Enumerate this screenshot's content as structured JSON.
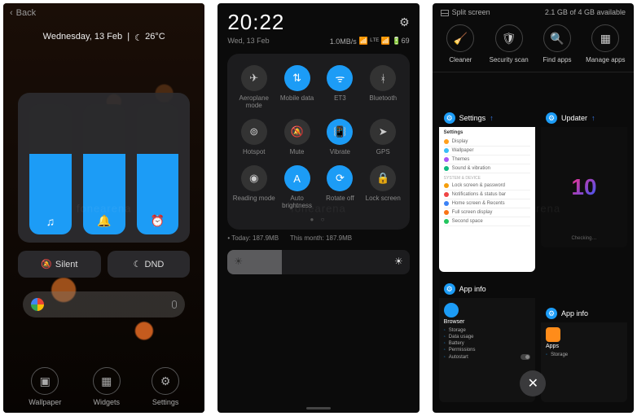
{
  "screen1": {
    "back": "Back",
    "date_line": "Wednesday, 13 Feb",
    "moon_icon": "☾",
    "temp": "26°C",
    "volume_sliders": [
      {
        "icon": "♫",
        "level_pct": 62
      },
      {
        "icon": "🔔",
        "level_pct": 62
      },
      {
        "icon": "⏰",
        "level_pct": 62
      }
    ],
    "modes": {
      "silent": "Silent",
      "dnd": "DND"
    },
    "dock": {
      "wallpaper": "Wallpaper",
      "widgets": "Widgets",
      "settings": "Settings"
    }
  },
  "screen2": {
    "clock": "20:22",
    "date": "Wed, 13 Feb",
    "net_speed": "1.0MB/s",
    "status_icons": "📶 ᴸᵀᴱ 📶 🔋69",
    "gear_icon": "⚙",
    "qs": [
      {
        "icon": "✈",
        "label": "Aeroplane mode",
        "on": false
      },
      {
        "icon": "⇅",
        "label": "Mobile data",
        "on": true
      },
      {
        "icon": "ᯤ",
        "label": "ET3",
        "on": true
      },
      {
        "icon": "ᚼ",
        "label": "Bluetooth",
        "on": false
      },
      {
        "icon": "⊚",
        "label": "Hotspot",
        "on": false
      },
      {
        "icon": "🔕",
        "label": "Mute",
        "on": false
      },
      {
        "icon": "📳",
        "label": "Vibrate",
        "on": true
      },
      {
        "icon": "➤",
        "label": "GPS",
        "on": false
      },
      {
        "icon": "◉",
        "label": "Reading mode",
        "on": false
      },
      {
        "icon": "A",
        "label": "Auto brightness",
        "on": true
      },
      {
        "icon": "⟳",
        "label": "Rotate off",
        "on": true
      },
      {
        "icon": "🔒",
        "label": "Lock screen",
        "on": false
      }
    ],
    "data_today": "Today: 187.9MB",
    "data_month": "This month: 187.9MB",
    "brightness_pct": 30
  },
  "screen3": {
    "split": "Split screen",
    "mem": "2.1 GB of 4 GB available",
    "tools": [
      {
        "icon": "🧹",
        "label": "Cleaner"
      },
      {
        "icon": "🛡",
        "label": "Security scan"
      },
      {
        "icon": "🔍",
        "label": "Find apps"
      },
      {
        "icon": "▦",
        "label": "Manage apps"
      }
    ],
    "cards": {
      "settings": {
        "title": "Settings",
        "items": [
          {
            "color": "#ff9f1c",
            "label": "Display"
          },
          {
            "color": "#38bdf8",
            "label": "Wallpaper"
          },
          {
            "color": "#a855f7",
            "label": "Themes"
          },
          {
            "color": "#10b981",
            "label": "Sound & vibration"
          },
          {
            "section": "SYSTEM & DEVICE"
          },
          {
            "color": "#f59e0b",
            "label": "Lock screen & password"
          },
          {
            "color": "#ef4444",
            "label": "Notifications & status bar"
          },
          {
            "color": "#3b82f6",
            "label": "Home screen & Recents"
          },
          {
            "color": "#f97316",
            "label": "Full screen display"
          },
          {
            "color": "#22c55e",
            "label": "Second space"
          }
        ]
      },
      "updater": {
        "title": "Updater",
        "logo": "10",
        "status": "Checking…"
      },
      "appinfo1": {
        "title": "App info",
        "app_name": "Browser",
        "lines": [
          "Storage",
          "Data usage",
          "Battery",
          "Permissions",
          "Autostart"
        ]
      },
      "appinfo2": {
        "title": "App info",
        "app_name": "Apps",
        "lines": [
          "Storage"
        ]
      }
    },
    "close_icon": "✕"
  },
  "watermark": "fonearena"
}
